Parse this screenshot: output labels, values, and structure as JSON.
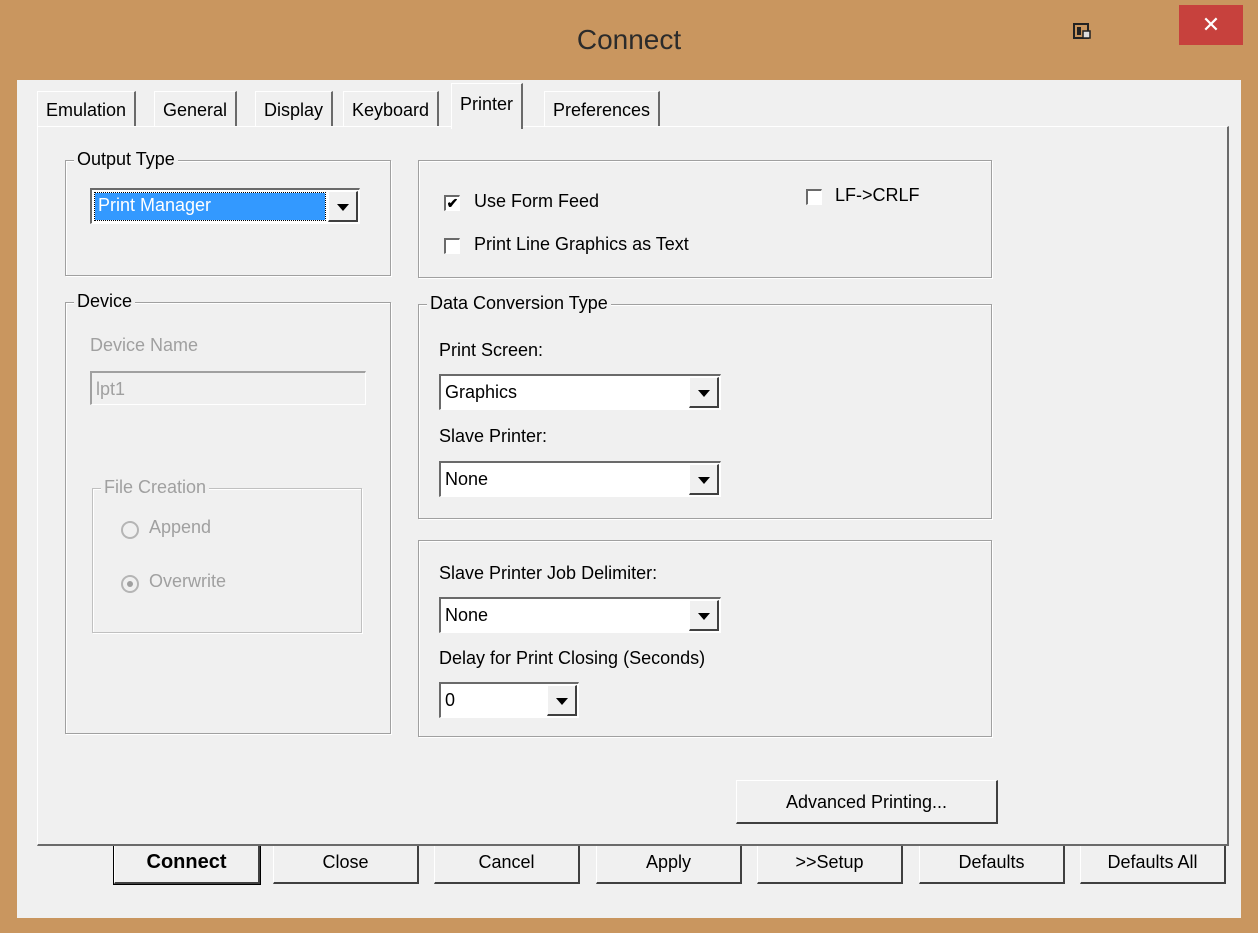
{
  "window": {
    "title": "Connect",
    "close_label": "✕"
  },
  "tabs": [
    {
      "label": "Emulation"
    },
    {
      "label": "General"
    },
    {
      "label": "Display"
    },
    {
      "label": "Keyboard"
    },
    {
      "label": "Printer"
    },
    {
      "label": "Preferences"
    }
  ],
  "active_tab": "Printer",
  "output_type": {
    "legend": "Output Type",
    "value": "Print Manager"
  },
  "options": {
    "use_form_feed": {
      "label": "Use Form Feed",
      "checked": true,
      "mark": "✔"
    },
    "lf_crlf": {
      "label": "LF->CRLF",
      "checked": false
    },
    "print_line_graphics": {
      "label": "Print Line Graphics as Text",
      "checked": false
    }
  },
  "device": {
    "legend": "Device",
    "name_label": "Device Name",
    "name_value": "lpt1",
    "file_creation": {
      "legend": "File Creation",
      "append_label": "Append",
      "overwrite_label": "Overwrite",
      "selected": "Overwrite"
    }
  },
  "data_conversion": {
    "legend": "Data Conversion Type",
    "print_screen_label": "Print Screen:",
    "print_screen_value": "Graphics",
    "slave_printer_label": "Slave Printer:",
    "slave_printer_value": "None"
  },
  "slave_job": {
    "delimiter_label": "Slave Printer Job Delimiter:",
    "delimiter_value": "None",
    "delay_label": "Delay for Print Closing (Seconds)",
    "delay_value": "0"
  },
  "advanced_printing_label": "Advanced Printing...",
  "buttons": {
    "connect": "Connect",
    "close": "Close",
    "cancel": "Cancel",
    "apply": "Apply",
    "setup": ">>Setup",
    "defaults": "Defaults",
    "defaults_all": "Defaults All"
  },
  "colors": {
    "frame": "#c9965f",
    "close_button": "#c7413d",
    "selection": "#3399ff",
    "dialog_bg": "#f0f0f0"
  }
}
